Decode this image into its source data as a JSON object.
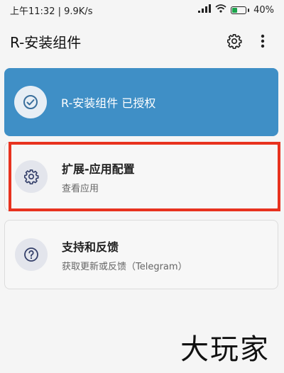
{
  "status_bar": {
    "time_speed": "上午11:32 | 9.9K/s",
    "battery_text": "40%",
    "battery_level": 0.4,
    "battery_color": "#1aa34a"
  },
  "app_bar": {
    "title": "R-安装组件",
    "settings_icon": "gear-icon",
    "menu_icon": "more-vertical-icon"
  },
  "cards": {
    "authorized": {
      "title": "R-安装组件 已授权",
      "icon": "check-circle-icon",
      "color": "#3f8fc6"
    },
    "extension": {
      "title": "扩展-应用配置",
      "subtitle": "查看应用",
      "icon": "gear-icon"
    },
    "support": {
      "title": "支持和反馈",
      "subtitle": "获取更新或反馈（Telegram）",
      "icon": "help-circle-icon"
    }
  },
  "watermark": "大玩家",
  "highlight_color": "#e8321f"
}
